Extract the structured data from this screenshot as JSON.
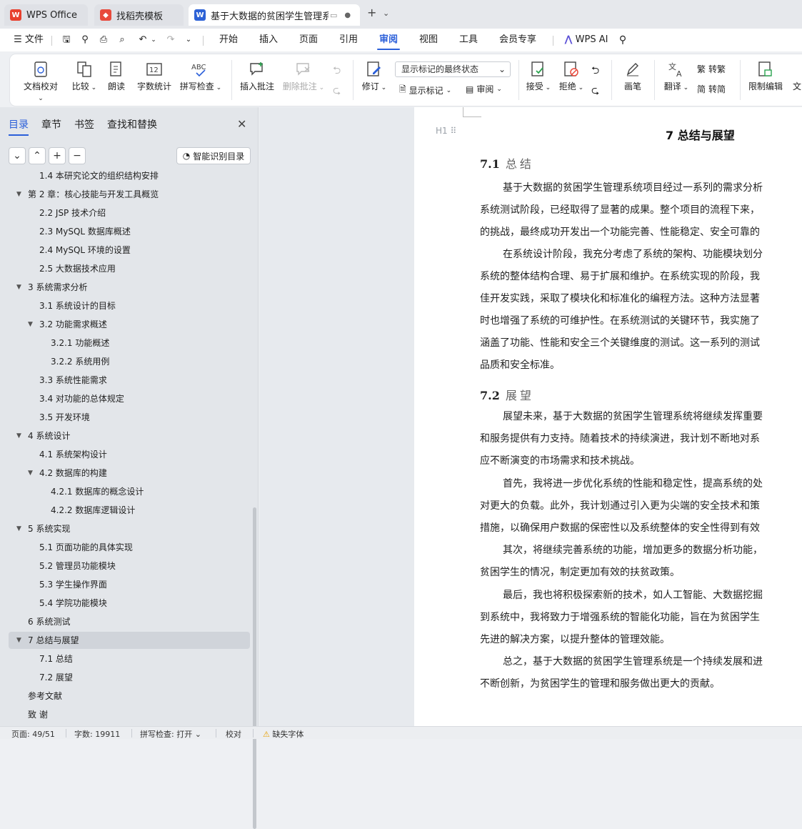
{
  "tabs": [
    {
      "label": "WPS Office"
    },
    {
      "label": "找稻壳模板"
    },
    {
      "label": "基于大数据的贫困学生管理系统"
    }
  ],
  "menu": {
    "file": "文件",
    "items": [
      "开始",
      "插入",
      "页面",
      "引用",
      "审阅",
      "视图",
      "工具",
      "会员专享"
    ],
    "active": "审阅",
    "ai": "WPS AI"
  },
  "ribbon": {
    "doc_check": "文档校对",
    "compare": "比较",
    "read_aloud": "朗读",
    "word_count": "字数统计",
    "spell_check": "拼写检查",
    "insert_comment": "插入批注",
    "delete_comment": "删除批注",
    "revise": "修订",
    "mark_state": "显示标记的最终状态",
    "show_marks": "显示标记",
    "review_pane": "审阅",
    "accept": "接受",
    "reject": "拒绝",
    "pen": "画笔",
    "translate": "翻译",
    "to_trad": "转繁",
    "to_simp": "转简",
    "restrict_edit": "限制编辑",
    "doc_more": "文"
  },
  "sidebar": {
    "tabs": [
      "目录",
      "章节",
      "书签",
      "查找和替换"
    ],
    "smart_toc": "智能识别目录",
    "toc": [
      {
        "label": "1.4 本研究论文的组织结构安排",
        "level": 2
      },
      {
        "label": "第 2 章：核心技能与开发工具概览",
        "level": 1,
        "expanded": true
      },
      {
        "label": "2.2 JSP 技术介绍",
        "level": 2
      },
      {
        "label": "2.3 MySQL  数据库概述",
        "level": 2
      },
      {
        "label": "2.4 MySQL 环境的设置",
        "level": 2
      },
      {
        "label": "2.5 大数据技术应用",
        "level": 2
      },
      {
        "label": "3 系统需求分析",
        "level": 1,
        "expanded": true
      },
      {
        "label": "3.1 系统设计的目标",
        "level": 2
      },
      {
        "label": "3.2  功能需求概述",
        "level": 2,
        "expanded": true
      },
      {
        "label": "3.2.1  功能概述",
        "level": 3
      },
      {
        "label": "3.2.2   系统用例",
        "level": 3
      },
      {
        "label": "3.3 系统性能需求",
        "level": 2
      },
      {
        "label": "3.4 对功能的总体规定",
        "level": 2
      },
      {
        "label": "3.5  开发环境",
        "level": 2
      },
      {
        "label": "4 系统设计",
        "level": 1,
        "expanded": true
      },
      {
        "label": "4.1   系统架构设计",
        "level": 2
      },
      {
        "label": "4.2  数据库的构建",
        "level": 2,
        "expanded": true
      },
      {
        "label": "4.2.1   数据库的概念设计",
        "level": 3
      },
      {
        "label": "4.2.2   数据库逻辑设计",
        "level": 3
      },
      {
        "label": "5 系统实现",
        "level": 1,
        "expanded": true
      },
      {
        "label": "5.1  页面功能的具体实现",
        "level": 2
      },
      {
        "label": "5.2 管理员功能模块",
        "level": 2
      },
      {
        "label": "5.3  学生操作界面",
        "level": 2
      },
      {
        "label": "5.4  学院功能模块",
        "level": 2
      },
      {
        "label": "6 系统测试",
        "level": 1
      },
      {
        "label": "7 总结与展望",
        "level": 1,
        "expanded": true,
        "selected": true
      },
      {
        "label": "7.1  总结",
        "level": 2
      },
      {
        "label": "7.2   展望",
        "level": 2
      },
      {
        "label": "参考文献",
        "level": 1
      },
      {
        "label": "致      谢",
        "level": 1
      }
    ]
  },
  "document": {
    "head_marker": "H1",
    "chapter_title": "7 总结与展望",
    "s1_num": "7.1",
    "s1_title": "总结",
    "s2_num": "7.2",
    "s2_title": "展望",
    "lines": [
      {
        "t": "基于大数据的贫困学生管理系统项目经过一系列的需求分析",
        "ind": true
      },
      {
        "t": "系统测试阶段，已经取得了显著的成果。整个项目的流程下来，",
        "ind": false
      },
      {
        "t": "的挑战，最终成功开发出一个功能完善、性能稳定、安全可靠的",
        "ind": false
      },
      {
        "t": "在系统设计阶段，我充分考虑了系统的架构、功能模块划分",
        "ind": true
      },
      {
        "t": "系统的整体结构合理、易于扩展和维护。在系统实现的阶段，我",
        "ind": false
      },
      {
        "t": "佳开发实践，采取了模块化和标准化的编程方法。这种方法显著",
        "ind": false
      },
      {
        "t": "时也增强了系统的可维护性。在系统测试的关键环节，我实施了",
        "ind": false
      },
      {
        "t": "涵盖了功能、性能和安全三个关键维度的测试。这一系列的测试",
        "ind": false
      },
      {
        "t": "品质和安全标准。",
        "ind": false
      },
      {
        "t": "展望未来，基于大数据的贫困学生管理系统将继续发挥重要",
        "ind": true
      },
      {
        "t": "和服务提供有力支持。随着技术的持续演进，我计划不断地对系",
        "ind": false
      },
      {
        "t": "应不断演变的市场需求和技术挑战。",
        "ind": false
      },
      {
        "t": "首先，我将进一步优化系统的性能和稳定性，提高系统的处",
        "ind": true
      },
      {
        "t": "对更大的负载。此外，我计划通过引入更为尖端的安全技术和策",
        "ind": false
      },
      {
        "t": "措施，以确保用户数据的保密性以及系统整体的安全性得到有效",
        "ind": false
      },
      {
        "t": "其次，将继续完善系统的功能，增加更多的数据分析功能，",
        "ind": true
      },
      {
        "t": "贫困学生的情况，制定更加有效的扶贫政策。",
        "ind": false
      },
      {
        "t": "最后，我也将积极探索新的技术，如人工智能、大数据挖掘",
        "ind": true
      },
      {
        "t": "到系统中，我将致力于增强系统的智能化功能，旨在为贫困学生",
        "ind": false
      },
      {
        "t": "先进的解决方案，以提升整体的管理效能。",
        "ind": false
      },
      {
        "t": "总之，基于大数据的贫困学生管理系统是一个持续发展和进",
        "ind": true
      },
      {
        "t": "不断创新，为贫困学生的管理和服务做出更大的贡献。",
        "ind": false
      }
    ]
  },
  "status": {
    "page": "页面: 49/51",
    "words": "字数: 19911",
    "spell": "拼写检查: 打开",
    "proof": "校对",
    "missing_font": "缺失字体"
  },
  "colors": {
    "accent": "#2b5fd9",
    "wps_red": "#e8402e",
    "docer_red": "#e84a3c",
    "doc_blue": "#2d62d6"
  }
}
